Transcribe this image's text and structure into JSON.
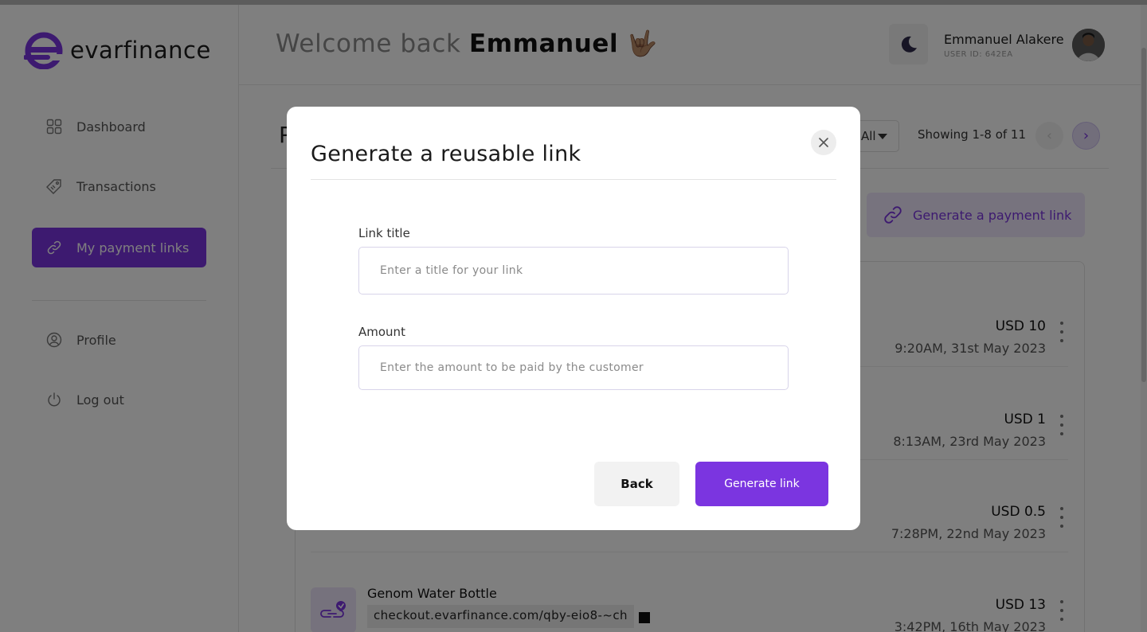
{
  "brand": {
    "name": "evarfinance",
    "accent": "#7b35e0"
  },
  "sidebar": {
    "items": [
      {
        "label": "Dashboard",
        "icon": "grid-icon"
      },
      {
        "label": "Transactions",
        "icon": "tag-icon"
      },
      {
        "label": "My payment links",
        "icon": "link-icon",
        "active": true
      },
      {
        "label": "Profile",
        "icon": "user-circle-icon"
      },
      {
        "label": "Log out",
        "icon": "power-icon"
      }
    ]
  },
  "header": {
    "welcome_prefix": "Welcome back",
    "welcome_name": "Emmanuel",
    "welcome_emoji": "🤟🏽",
    "user_name": "Emmanuel Alakere",
    "user_id": "USER ID: 642EA"
  },
  "main": {
    "title_visible": "P",
    "filter_value": "All",
    "showing": "Showing 1-8 of 11",
    "generate_payment_label": "Generate a payment link",
    "rows": [
      {
        "name": "",
        "url": "",
        "amount": "USD 10",
        "date": "9:20AM, 31st May 2023"
      },
      {
        "name": "",
        "url": "",
        "amount": "USD 1",
        "date": "8:13AM, 23rd May 2023"
      },
      {
        "name": "",
        "url": "",
        "amount": "USD 0.5",
        "date": "7:28PM, 22nd May 2023"
      },
      {
        "name": "Genom Water Bottle",
        "url": "checkout.evarfinance.com/qby-eio8-~ch",
        "amount": "USD 13",
        "date": "3:42PM, 16th May 2023"
      }
    ]
  },
  "modal": {
    "title": "Generate a reusable link",
    "link_title_label": "Link title",
    "link_title_placeholder": "Enter a title for your link",
    "amount_label": "Amount",
    "amount_placeholder": "Enter the amount to be paid by the customer",
    "back_label": "Back",
    "generate_label": "Generate link"
  }
}
